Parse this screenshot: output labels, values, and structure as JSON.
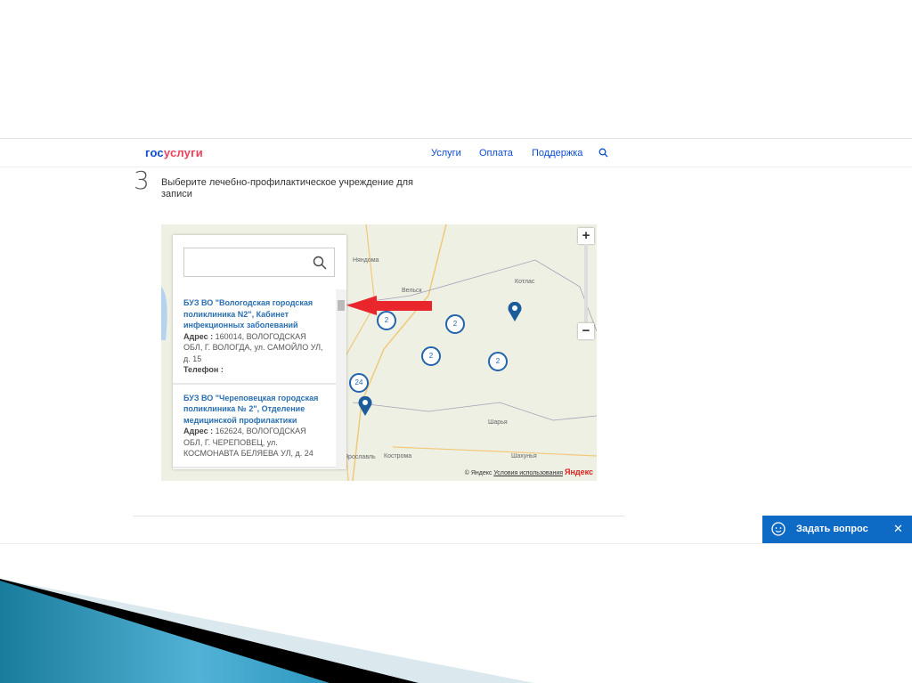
{
  "header": {
    "logo_part1": "гос",
    "logo_part2": "услуги",
    "nav": [
      "Услуги",
      "Оплата",
      "Поддержка"
    ]
  },
  "step": {
    "number": "3",
    "title": "Выберите лечебно-профилактическое учреждение для записи"
  },
  "map": {
    "search": {
      "value": "",
      "placeholder": ""
    },
    "items": [
      {
        "name": "БУЗ ВО \"Вологодская городская поликлиника N2\", Кабинет инфекционных заболеваний",
        "address_label": "Адрес :",
        "address": "160014, ВОЛОГОДСКАЯ ОБЛ, Г. ВОЛОГДА, ул. САМОЙЛО УЛ, д. 15",
        "phone_label": "Телефон :"
      },
      {
        "name": "БУЗ ВО \"Череповецкая городская поликлиника № 2\", Отделение медицинской профилактики",
        "address_label": "Адрес :",
        "address": "162624, ВОЛОГОДСКАЯ ОБЛ, Г. ЧЕРЕПОВЕЦ, ул. КОСМОНАВТА БЕЛЯЕВА УЛ, д. 24"
      }
    ],
    "cities": [
      "Няндома",
      "Вельск",
      "Котлас",
      "Шарья",
      "Шахунья",
      "Ярославль",
      "Кострома"
    ],
    "clusters": [
      "2",
      "2",
      "2",
      "2",
      "24"
    ],
    "zoom_in": "+",
    "zoom_out": "−",
    "attribution": "© Яндекс",
    "terms": "Условия использования",
    "brand": "Яндекс"
  },
  "chat": {
    "label": "Задать вопрос",
    "close": "✕"
  },
  "colors": {
    "accent": "#0d4cd3",
    "red": "#ee3f58",
    "chat": "#0d6ac5"
  }
}
